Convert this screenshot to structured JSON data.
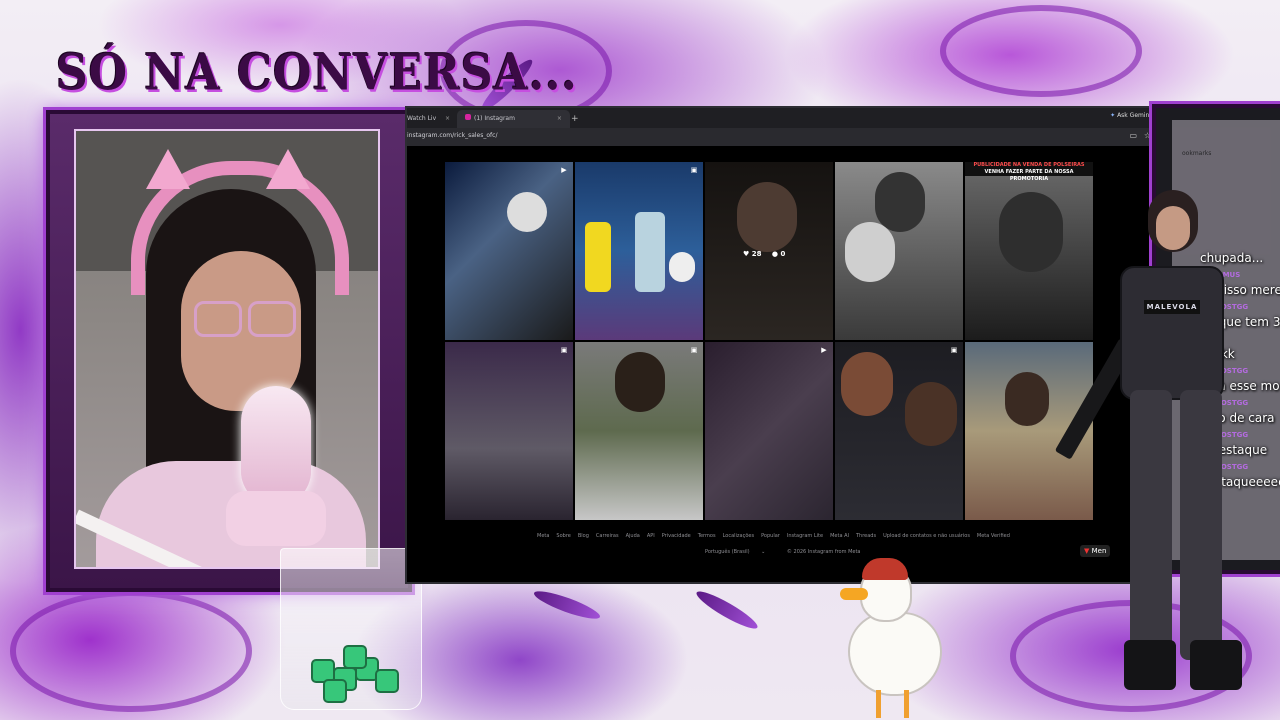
{
  "overlay": {
    "title": "SÓ NA CONVERSA..."
  },
  "browser": {
    "tabs": [
      {
        "label": "Watch Liv"
      },
      {
        "label": "(1) Instagram"
      }
    ],
    "ask_gemini": "Ask Gemini",
    "url": "instagram.com/rick_sales_ofc/",
    "bookmarks_label": "ookmarks"
  },
  "instagram": {
    "banner_line1": "PUBLICIDADE NA VENDA DE POLSEIRAS",
    "banner_line2": "VENHA FAZER PARTE DA NOSSA PROMOTORIA",
    "hover_likes": "28",
    "hover_comments": "0",
    "footer_links": [
      "Meta",
      "Sobre",
      "Blog",
      "Carreiras",
      "Ajuda",
      "API",
      "Privacidade",
      "Termos",
      "Localizações",
      "Popular",
      "Instagram Lite",
      "Meta AI",
      "Threads",
      "Upload de contatos e não usuários",
      "Meta Verified"
    ],
    "language": "Português (Brasil)",
    "copyright": "© 2026 Instagram from Meta"
  },
  "chat": {
    "messages": [
      {
        "user": "",
        "text": "chupada..."
      },
      {
        "user": "ODRAMUS",
        "text": "por isso merece"
      },
      {
        "user": "BOBLOSTGG",
        "text": "eh que tem 3"
      },
      {
        "user": "",
        "text": "kkkkk"
      },
      {
        "user": "BOBLOSTGG",
        "text": "olha esse mo"
      },
      {
        "user": "BOBLOSTGG",
        "text": "logo de cara"
      },
      {
        "user": "BOBLOSTGG",
        "text": "o destaque"
      },
      {
        "user": "BOBLOSTGG",
        "text": "destaqueeeeeee"
      }
    ],
    "menu_label": "Men"
  },
  "character": {
    "vest_patch": "MALEVOLA"
  },
  "colors": {
    "accent_purple": "#a040d0",
    "chat_username": "#b46be0",
    "ig_background": "#000000"
  }
}
